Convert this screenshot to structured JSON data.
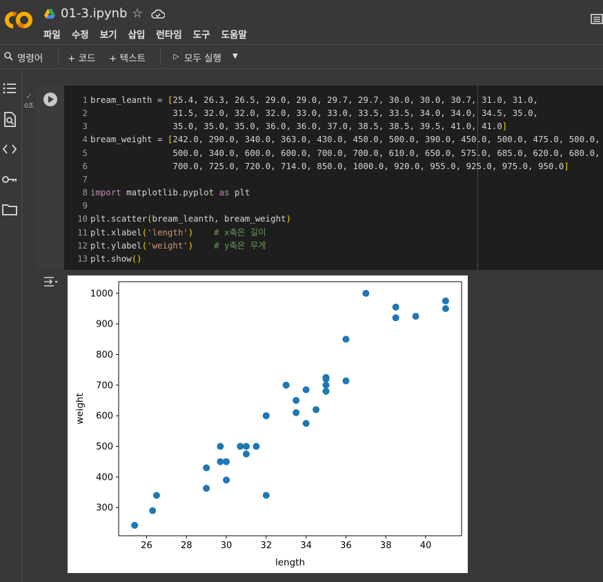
{
  "app": {
    "notebook_title": "01-3.ipynb"
  },
  "menu": [
    "파일",
    "수정",
    "보기",
    "삽입",
    "런타임",
    "도구",
    "도움말"
  ],
  "toolbar": {
    "commands_label": "명령어",
    "code_label": "+ 코드",
    "text_label": "+ 텍스트",
    "run_all_label": "모두 실행"
  },
  "cell": {
    "exec_time": "0초",
    "lines": [
      {
        "n": "1",
        "html": "bream_leanth = <span class='br'>[</span>25.4, 26.3, 26.5, 29.0, 29.0, 29.7, 29.7, 30.0, 30.0, 30.7, 31.0, 31.0,"
      },
      {
        "n": "2",
        "html": "                31.5, 32.0, 32.0, 32.0, 33.0, 33.0, 33.5, 33.5, 34.0, 34.0, 34.5, 35.0,"
      },
      {
        "n": "3",
        "html": "                35.0, 35.0, 35.0, 36.0, 36.0, 37.0, 38.5, 38.5, 39.5, 41.0, 41.0<span class='br'>]</span>"
      },
      {
        "n": "4",
        "html": "bream_weight = <span class='br'>[</span>242.0, 290.0, 340.0, 363.0, 430.0, 450.0, 500.0, 390.0, 450.0, 500.0, 475.0, 500.0,"
      },
      {
        "n": "5",
        "html": "                500.0, 340.0, 600.0, 600.0, 700.0, 700.0, 610.0, 650.0, 575.0, 685.0, 620.0, 680.0,"
      },
      {
        "n": "6",
        "html": "                700.0, 725.0, 720.0, 714.0, 850.0, 1000.0, 920.0, 955.0, 925.0, 975.0, 950.0<span class='br'>]</span>"
      },
      {
        "n": "7",
        "html": ""
      },
      {
        "n": "8",
        "html": "<span class='kw'>import</span> matplotlib.pyplot <span class='kw'>as</span> plt"
      },
      {
        "n": "9",
        "html": ""
      },
      {
        "n": "10",
        "html": "plt.scatter<span class='br'>(</span>bream_leanth, bream_weight<span class='br'>)</span>"
      },
      {
        "n": "11",
        "html": "plt.xlabel<span class='br'>(</span><span class='str'>'length'</span><span class='br'>)</span>    <span class='cm'># x축은 길이</span>"
      },
      {
        "n": "12",
        "html": "plt.ylabel<span class='br'>(</span><span class='str'>'weight'</span><span class='br'>)</span>    <span class='cm'># y축은 무게</span>"
      },
      {
        "n": "13",
        "html": "plt.show<span class='br'>()</span>"
      }
    ]
  },
  "chart_data": {
    "type": "scatter",
    "xlabel": "length",
    "ylabel": "weight",
    "xlim": [
      24.6,
      41.8
    ],
    "ylim": [
      208,
      1038
    ],
    "xticks": [
      26,
      28,
      30,
      32,
      34,
      36,
      38,
      40
    ],
    "yticks": [
      300,
      400,
      500,
      600,
      700,
      800,
      900,
      1000
    ],
    "color": "#1f77b4",
    "x": [
      25.4,
      26.3,
      26.5,
      29.0,
      29.0,
      29.7,
      29.7,
      30.0,
      30.0,
      30.7,
      31.0,
      31.0,
      31.5,
      32.0,
      32.0,
      32.0,
      33.0,
      33.0,
      33.5,
      33.5,
      34.0,
      34.0,
      34.5,
      35.0,
      35.0,
      35.0,
      35.0,
      36.0,
      36.0,
      37.0,
      38.5,
      38.5,
      39.5,
      41.0,
      41.0
    ],
    "y": [
      242.0,
      290.0,
      340.0,
      363.0,
      430.0,
      450.0,
      500.0,
      390.0,
      450.0,
      500.0,
      475.0,
      500.0,
      500.0,
      340.0,
      600.0,
      600.0,
      700.0,
      700.0,
      610.0,
      650.0,
      575.0,
      685.0,
      620.0,
      680.0,
      700.0,
      725.0,
      720.0,
      714.0,
      850.0,
      1000.0,
      920.0,
      955.0,
      925.0,
      975.0,
      950.0
    ]
  }
}
